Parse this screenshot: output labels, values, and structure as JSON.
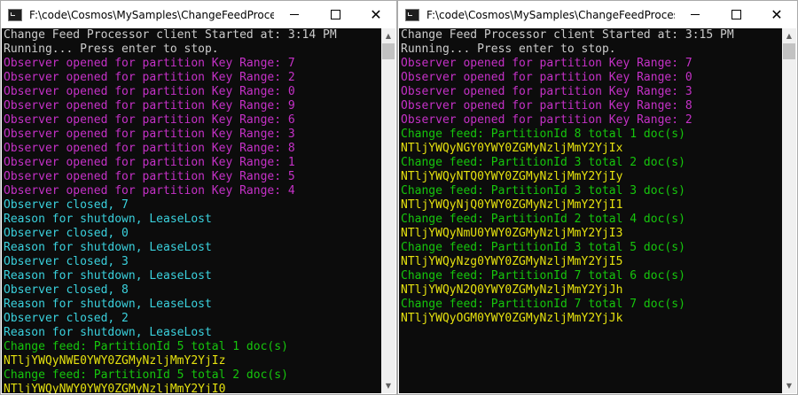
{
  "colors": {
    "white": "#cccccc",
    "magenta": "#c531c7",
    "cyan": "#3ad1dd",
    "green": "#16c60c",
    "yellow": "#e5e10f",
    "console_bg": "#0c0c0c"
  },
  "icons": {
    "app": "console-app-icon",
    "minimize": "minimize-icon",
    "maximize": "maximize-icon",
    "close": "close-icon",
    "scroll_up": "chevron-up-icon",
    "scroll_down": "chevron-down-icon"
  },
  "windows": [
    {
      "title": "F:\\code\\Cosmos\\MySamples\\ChangeFeedProcessor...",
      "lines": [
        {
          "text": "Change Feed Processor client Started at: 3:14 PM",
          "color": "white"
        },
        {
          "text": "Running... Press enter to stop.",
          "color": "white"
        },
        {
          "text": "Observer opened for partition Key Range: 7",
          "color": "magenta"
        },
        {
          "text": "Observer opened for partition Key Range: 2",
          "color": "magenta"
        },
        {
          "text": "Observer opened for partition Key Range: 0",
          "color": "magenta"
        },
        {
          "text": "Observer opened for partition Key Range: 9",
          "color": "magenta"
        },
        {
          "text": "Observer opened for partition Key Range: 6",
          "color": "magenta"
        },
        {
          "text": "Observer opened for partition Key Range: 3",
          "color": "magenta"
        },
        {
          "text": "Observer opened for partition Key Range: 8",
          "color": "magenta"
        },
        {
          "text": "Observer opened for partition Key Range: 1",
          "color": "magenta"
        },
        {
          "text": "Observer opened for partition Key Range: 5",
          "color": "magenta"
        },
        {
          "text": "Observer opened for partition Key Range: 4",
          "color": "magenta"
        },
        {
          "text": "Observer closed, 7",
          "color": "cyan"
        },
        {
          "text": "Reason for shutdown, LeaseLost",
          "color": "cyan"
        },
        {
          "text": "Observer closed, 0",
          "color": "cyan"
        },
        {
          "text": "Reason for shutdown, LeaseLost",
          "color": "cyan"
        },
        {
          "text": "Observer closed, 3",
          "color": "cyan"
        },
        {
          "text": "Reason for shutdown, LeaseLost",
          "color": "cyan"
        },
        {
          "text": "Observer closed, 8",
          "color": "cyan"
        },
        {
          "text": "Reason for shutdown, LeaseLost",
          "color": "cyan"
        },
        {
          "text": "Observer closed, 2",
          "color": "cyan"
        },
        {
          "text": "Reason for shutdown, LeaseLost",
          "color": "cyan"
        },
        {
          "text": "Change feed: PartitionId 5 total 1 doc(s)",
          "color": "green"
        },
        {
          "text": "NTljYWQyNWE0YWY0ZGMyNzljMmY2YjIz",
          "color": "yellow"
        },
        {
          "text": "Change feed: PartitionId 5 total 2 doc(s)",
          "color": "green"
        },
        {
          "text": "NTljYWQyNWY0YWY0ZGMyNzljMmY2YjI0",
          "color": "yellow"
        }
      ]
    },
    {
      "title": "F:\\code\\Cosmos\\MySamples\\ChangeFeedProcess...",
      "lines": [
        {
          "text": "Change Feed Processor client Started at: 3:15 PM",
          "color": "white"
        },
        {
          "text": "Running... Press enter to stop.",
          "color": "white"
        },
        {
          "text": "Observer opened for partition Key Range: 7",
          "color": "magenta"
        },
        {
          "text": "Observer opened for partition Key Range: 0",
          "color": "magenta"
        },
        {
          "text": "Observer opened for partition Key Range: 3",
          "color": "magenta"
        },
        {
          "text": "Observer opened for partition Key Range: 8",
          "color": "magenta"
        },
        {
          "text": "Observer opened for partition Key Range: 2",
          "color": "magenta"
        },
        {
          "text": "Change feed: PartitionId 8 total 1 doc(s)",
          "color": "green"
        },
        {
          "text": "NTljYWQyNGY0YWY0ZGMyNzljMmY2YjIx",
          "color": "yellow"
        },
        {
          "text": "Change feed: PartitionId 3 total 2 doc(s)",
          "color": "green"
        },
        {
          "text": "NTljYWQyNTQ0YWY0ZGMyNzljMmY2YjIy",
          "color": "yellow"
        },
        {
          "text": "Change feed: PartitionId 3 total 3 doc(s)",
          "color": "green"
        },
        {
          "text": "NTljYWQyNjQ0YWY0ZGMyNzljMmY2YjI1",
          "color": "yellow"
        },
        {
          "text": "Change feed: PartitionId 2 total 4 doc(s)",
          "color": "green"
        },
        {
          "text": "NTljYWQyNmU0YWY0ZGMyNzljMmY2YjI3",
          "color": "yellow"
        },
        {
          "text": "Change feed: PartitionId 3 total 5 doc(s)",
          "color": "green"
        },
        {
          "text": "NTljYWQyNzg0YWY0ZGMyNzljMmY2YjI5",
          "color": "yellow"
        },
        {
          "text": "Change feed: PartitionId 7 total 6 doc(s)",
          "color": "green"
        },
        {
          "text": "NTljYWQyN2Q0YWY0ZGMyNzljMmY2YjJh",
          "color": "yellow"
        },
        {
          "text": "Change feed: PartitionId 7 total 7 doc(s)",
          "color": "green"
        },
        {
          "text": "NTljYWQyOGM0YWY0ZGMyNzljMmY2YjJk",
          "color": "yellow"
        }
      ]
    }
  ]
}
